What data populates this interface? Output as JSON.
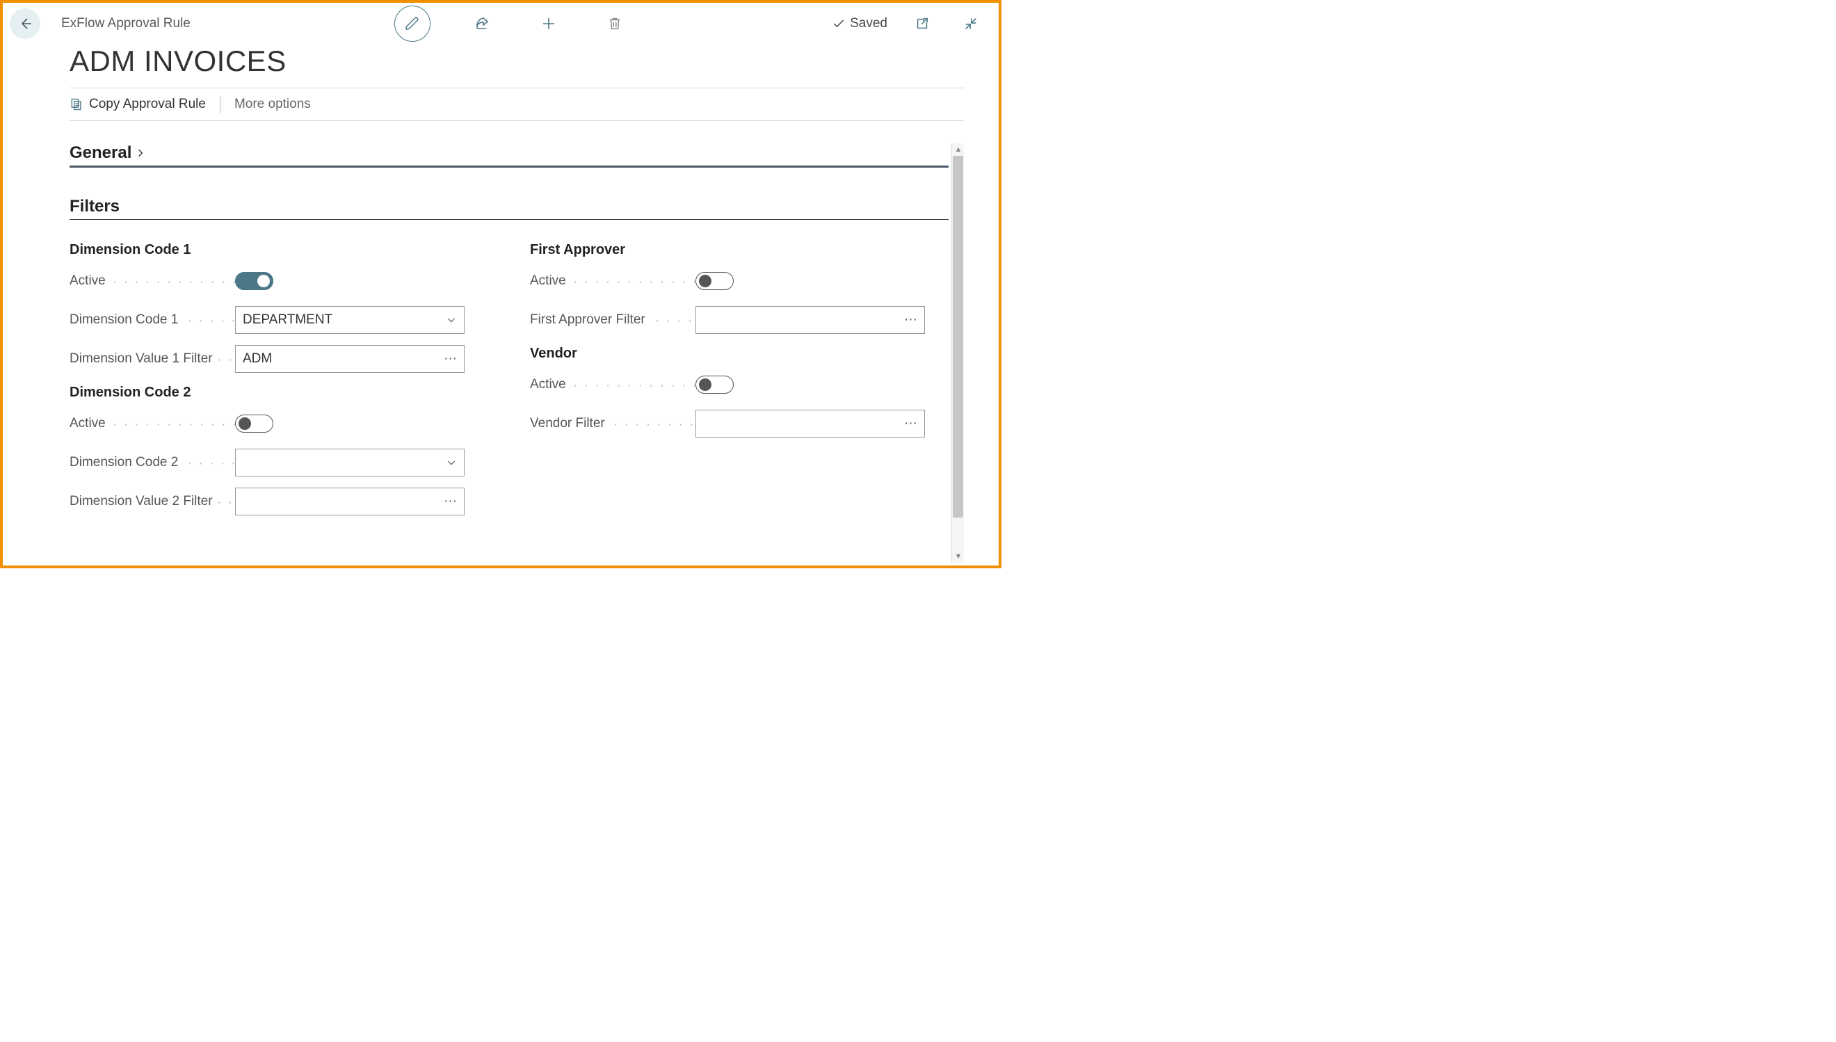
{
  "header": {
    "breadcrumb": "ExFlow Approval Rule",
    "saved_label": "Saved"
  },
  "page_title": "ADM INVOICES",
  "actions": {
    "copy_label": "Copy Approval Rule",
    "more_label": "More options"
  },
  "sections": {
    "general_label": "General",
    "filters_label": "Filters"
  },
  "filters": {
    "dim1": {
      "group_label": "Dimension Code 1",
      "active_label": "Active",
      "active_on": true,
      "code_label": "Dimension Code 1",
      "code_value": "DEPARTMENT",
      "filter_label": "Dimension Value 1 Filter",
      "filter_value": "ADM"
    },
    "dim2": {
      "group_label": "Dimension Code 2",
      "active_label": "Active",
      "active_on": false,
      "code_label": "Dimension Code 2",
      "code_value": "",
      "filter_label": "Dimension Value 2 Filter",
      "filter_value": ""
    },
    "first_approver": {
      "group_label": "First Approver",
      "active_label": "Active",
      "active_on": false,
      "filter_label": "First Approver Filter",
      "filter_value": ""
    },
    "vendor": {
      "group_label": "Vendor",
      "active_label": "Active",
      "active_on": false,
      "filter_label": "Vendor Filter",
      "filter_value": ""
    }
  }
}
